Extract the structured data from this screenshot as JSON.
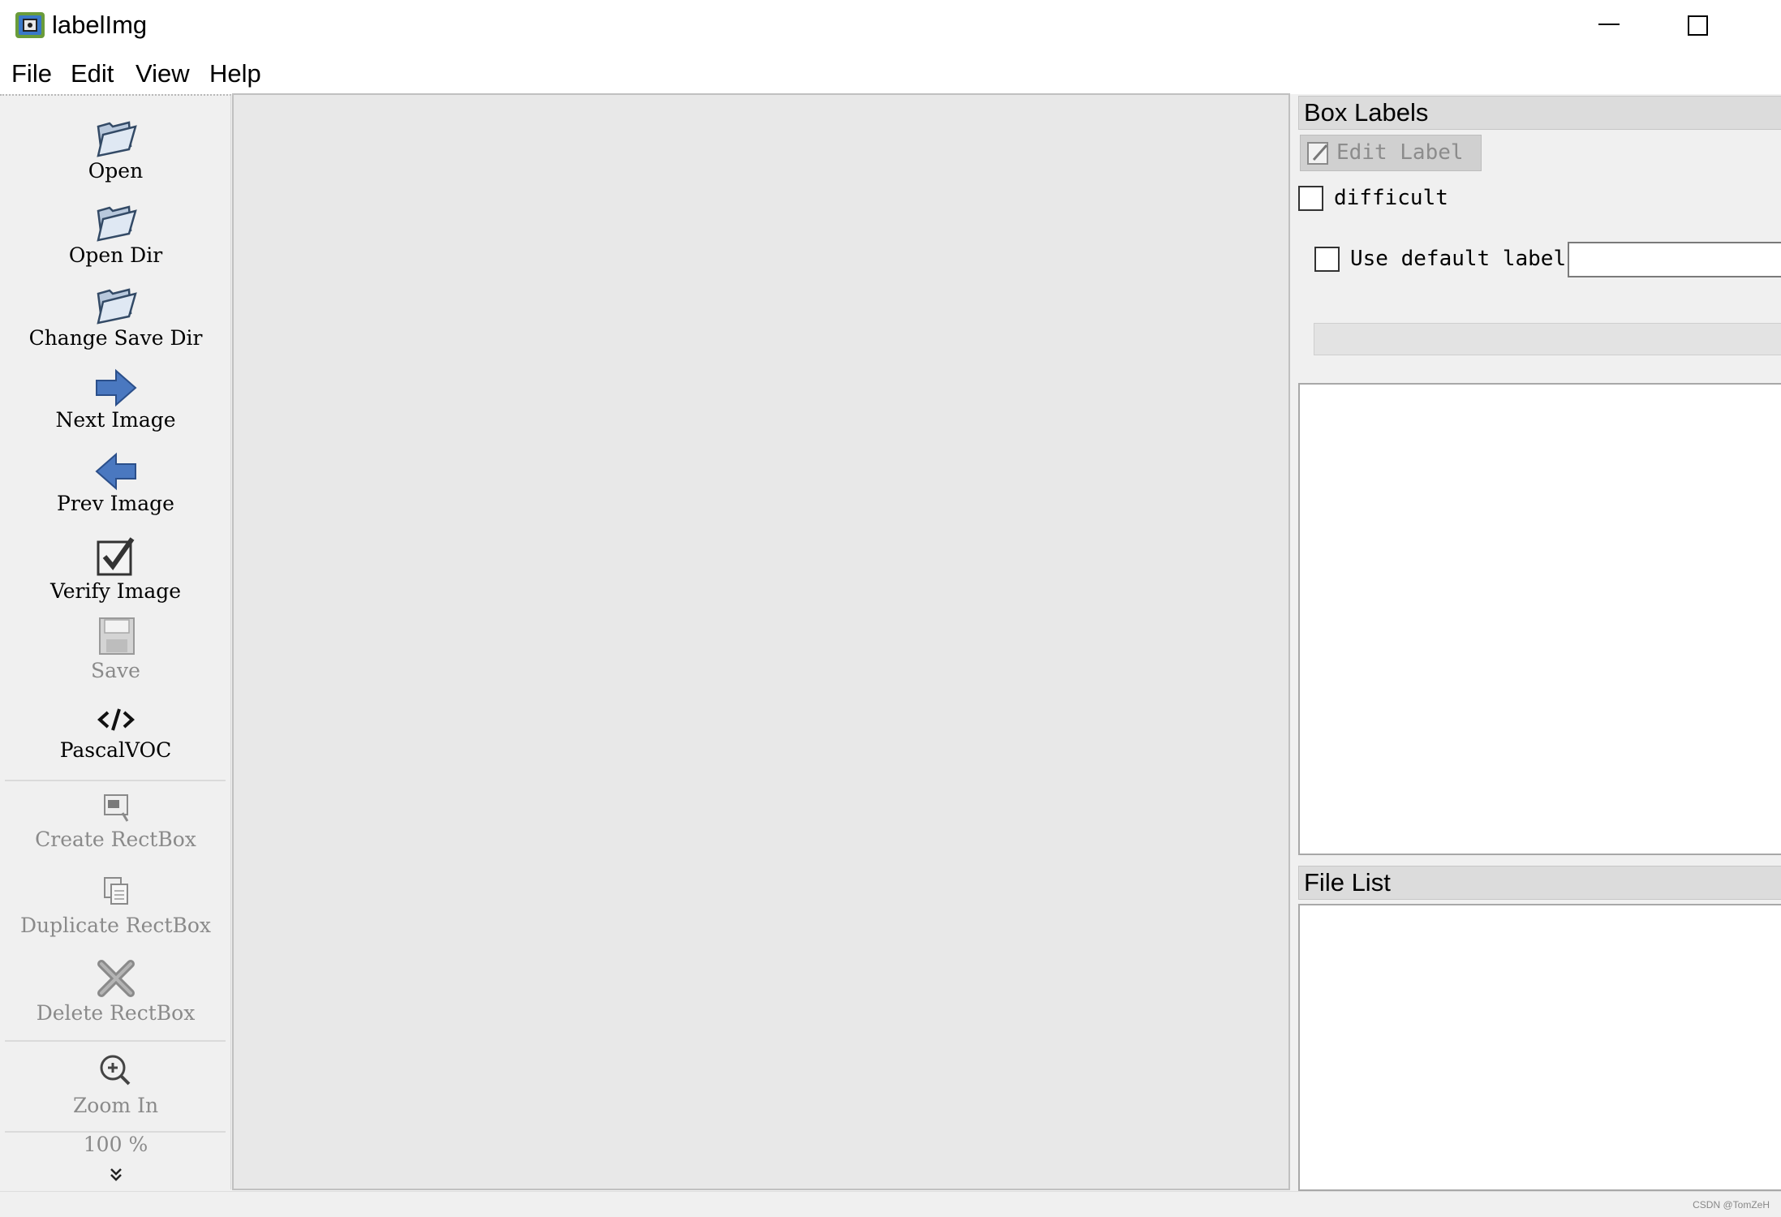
{
  "window": {
    "title": "labelImg",
    "icon": "labelimg-app-icon",
    "minimize_icon": "minimize-icon",
    "maximize_icon": "maximize-icon"
  },
  "menu": [
    "File",
    "Edit",
    "View",
    "Help"
  ],
  "toolbar": {
    "tools": [
      {
        "label": "Open",
        "icon": "folder-icon",
        "enabled": true
      },
      {
        "label": "Open Dir",
        "icon": "folder-icon",
        "enabled": true
      },
      {
        "label": "Change Save Dir",
        "icon": "folder-icon",
        "enabled": true
      },
      {
        "label": "Next Image",
        "icon": "arrow-right-icon",
        "enabled": true
      },
      {
        "label": "Prev Image",
        "icon": "arrow-left-icon",
        "enabled": true
      },
      {
        "label": "Verify Image",
        "icon": "checkbox-icon",
        "enabled": true
      },
      {
        "label": "Save",
        "icon": "floppy-icon",
        "enabled": false
      },
      {
        "label": "PascalVOC",
        "icon": "code-icon",
        "enabled": true
      },
      {
        "label": "Create RectBox",
        "icon": "rectbox-icon",
        "enabled": false
      },
      {
        "label": "Duplicate RectBox",
        "icon": "duplicate-icon",
        "enabled": false
      },
      {
        "label": "Delete RectBox",
        "icon": "delete-x-icon",
        "enabled": false
      },
      {
        "label": "Zoom In",
        "icon": "zoom-in-icon",
        "enabled": false
      }
    ],
    "zoom_value": "100 %",
    "more_icon": "double-chevron-down-icon"
  },
  "dock": {
    "box_labels_title": "Box Labels",
    "edit_label": "Edit Label",
    "difficult_label": "difficult",
    "difficult_checked": false,
    "use_default_label": "Use default label",
    "use_default_checked": false,
    "default_label_value": "",
    "file_list_title": "File List"
  },
  "status_text": "",
  "watermark": "CSDN @TomZeH",
  "colors": {
    "canvas_bg": "#e8e8e8",
    "dock_title_bg": "#dcdcdc",
    "arrow_blue": "#4a78c0",
    "disabled_text": "#8a8a8a"
  }
}
